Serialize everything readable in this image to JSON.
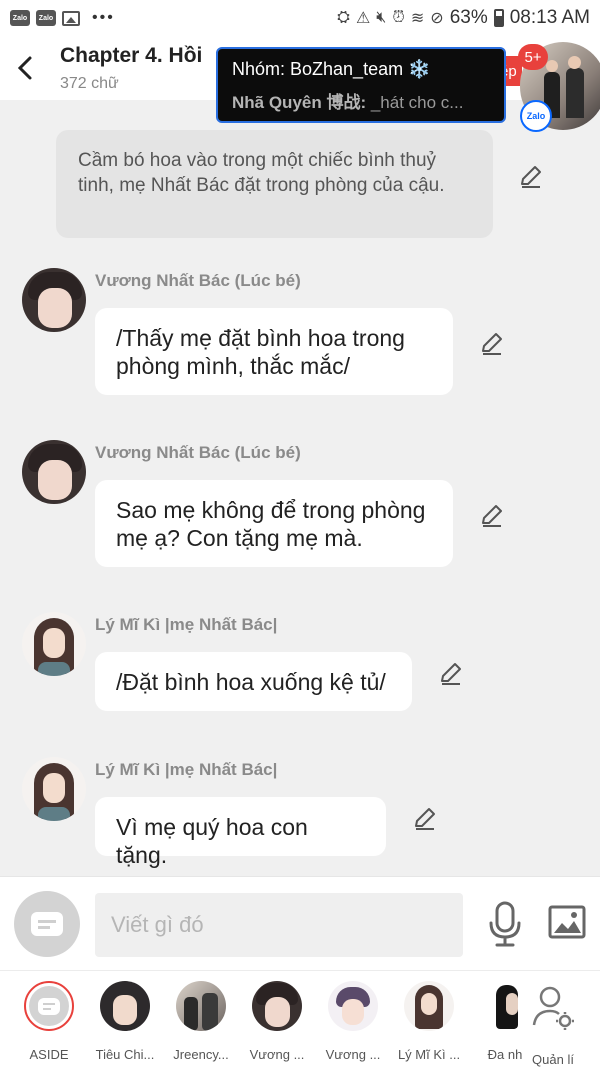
{
  "status_bar": {
    "time": "08:13 AM",
    "battery": "63%",
    "dots": "•••"
  },
  "header": {
    "back_glyph": "‹",
    "title": "Chapter 4. Hồi",
    "subtitle": "372 chữ",
    "badge": "5+",
    "tab_peek": "ép"
  },
  "popup": {
    "title": "Nhóm: BoZhan_team ❄️",
    "sender": "Nhã Quyên 博战:",
    "preview": " _hát cho c..."
  },
  "zalo_label": "Zalo",
  "messages": {
    "narration": "Cầm bó hoa vào trong một chiếc bình thuỷ tinh, mẹ Nhất Bác đặt trong phòng của cậu.",
    "m1_sender": "Vương Nhất Bác (Lúc bé)",
    "m1_text": "/Thấy mẹ đặt bình hoa trong phòng mình, thắc mắc/",
    "m2_sender": "Vương Nhất Bác (Lúc bé)",
    "m2_text": "Sao mẹ không để trong phòng mẹ ạ? Con tặng mẹ mà.",
    "m3_sender": "Lý Mĩ Kì |mẹ Nhất Bác|",
    "m3_text": "/Đặt bình hoa xuống kệ tủ/",
    "m4_sender": "Lý Mĩ Kì |mẹ Nhất Bác|",
    "m4_text": "Vì mẹ quý hoa con tặng."
  },
  "composer": {
    "placeholder": "Viết gì đó",
    "value": ""
  },
  "tabs": [
    {
      "label": "ASIDE"
    },
    {
      "label": "Tiêu Chi..."
    },
    {
      "label": "Jreency..."
    },
    {
      "label": "Vương ..."
    },
    {
      "label": "Vương ..."
    },
    {
      "label": "Lý Mĩ Kì ..."
    },
    {
      "label": "Đa nh"
    },
    {
      "label": "Quản lí"
    }
  ],
  "colors": {
    "accent_red": "#e8413c",
    "popup_border": "#2a6fe0",
    "zalo_blue": "#0a68ff"
  }
}
